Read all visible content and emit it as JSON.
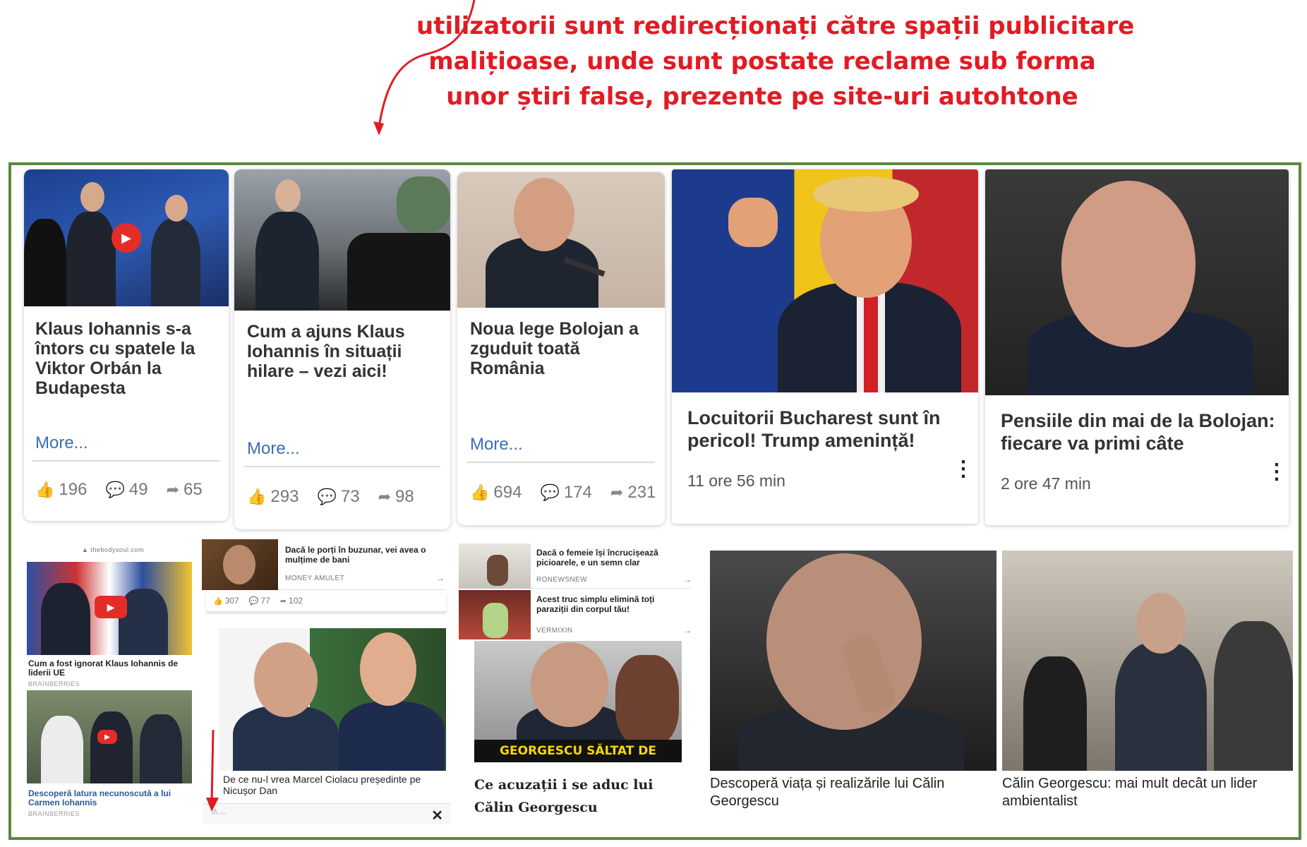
{
  "headline": {
    "lines": [
      "utilizatorii sunt redirecționați către spații publicitare",
      "malițioase, unde sunt postate reclame sub forma",
      "unor știri false, prezente pe site-uri autohtone"
    ],
    "color": "#e21b23"
  },
  "frame_color": "#5a8a3c",
  "top_cards": [
    {
      "title": "Klaus Iohannis s-a întors cu spatele la Viktor Orbán la Budapesta",
      "more": "More...",
      "likes": "196",
      "comments": "49",
      "shares": "65"
    },
    {
      "title": "Cum a ajuns Klaus Iohannis în situații hilare – vezi aici!",
      "more": "More...",
      "likes": "293",
      "comments": "73",
      "shares": "98"
    },
    {
      "title": "Noua lege Bolojan a zguduit toată România",
      "more": "More...",
      "likes": "694",
      "comments": "174",
      "shares": "231"
    }
  ],
  "news_cards": [
    {
      "title": "Locuitorii Bucharest sunt în pericol! Trump amenință!",
      "time": "11 ore 56 min"
    },
    {
      "title": "Pensiile din mai de la Bolojan: fiecare va primi câte",
      "time": "2 ore 47 min"
    }
  ],
  "left_widget": {
    "domain": "▲ thebodysoul.com",
    "item1_caption": "Cum a fost ignorat Klaus Iohannis de liderii UE",
    "item1_source": "BRAINBERRIES",
    "item2_caption": "Descoperă latura necunoscută a lui Carmen Iohannis",
    "item2_source": "BRAINBERRIES"
  },
  "mid_widget": {
    "ad_title": "Dacă le porți în buzunar, vei avea o mulțime de bani",
    "ad_source": "MONEY AMULET",
    "likes": "307",
    "comments": "77",
    "shares": "102",
    "caption": "De ce nu-l vrea Marcel Ciolacu președinte pe Nicușor Dan",
    "ad_badge": "⚠ ..."
  },
  "right_ads": [
    {
      "title": "Dacă o femeie își încrucișează picioarele, e un semn clar",
      "source": "RONEWSNEW"
    },
    {
      "title": "Acest truc simplu elimină toți paraziții din corpul tău!",
      "source": "VERMIXIN"
    }
  ],
  "georgescu_banner": "GEORGESCU SĂLTAT DE POLIȚIE",
  "georgescu_caption": "Ce acuzații i se aduc lui Călin Georgescu",
  "bottom_news": [
    {
      "caption": "Descoperă viața și realizările lui Călin Georgescu"
    },
    {
      "caption": "Călin Georgescu: mai mult decât un lider ambientalist"
    }
  ],
  "icons": {
    "like": "like-icon",
    "comment": "comment-icon",
    "share": "share-icon",
    "close": "close-icon",
    "play": "play-icon",
    "more": "more-vert-icon"
  }
}
